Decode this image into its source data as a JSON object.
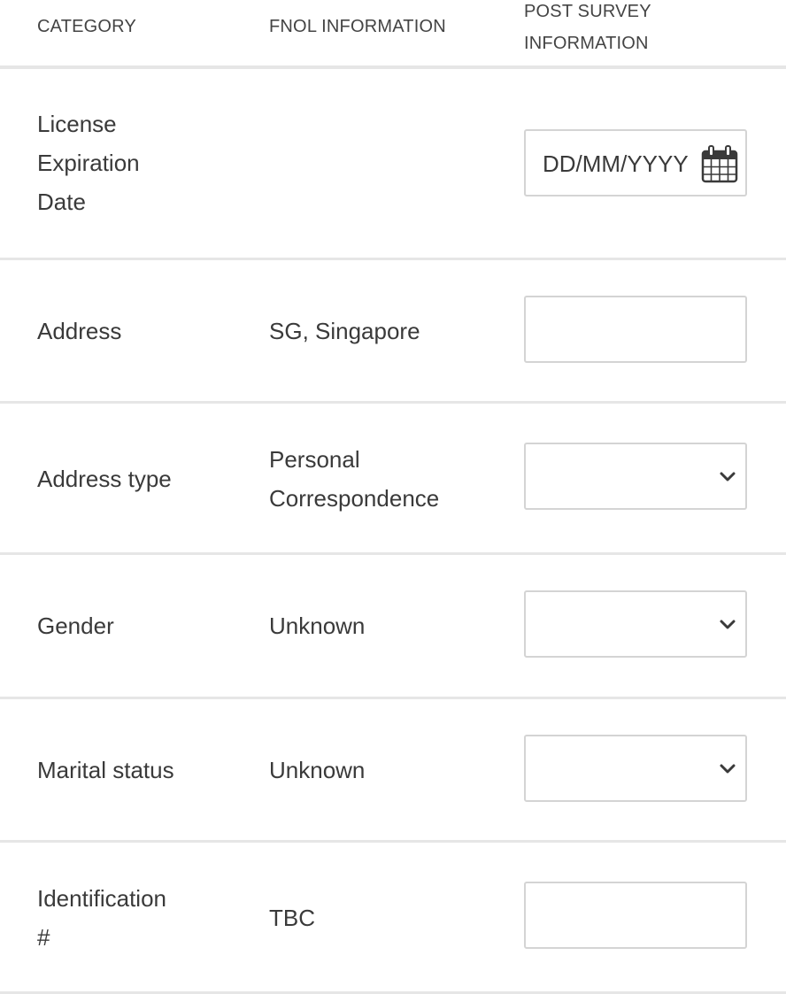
{
  "columns": {
    "category": "CATEGORY",
    "fnol": "FNOL INFORMATION",
    "post_survey_line1": "POST SURVEY",
    "post_survey_line2": "INFORMATION"
  },
  "rows": [
    {
      "category_lines": [
        "License",
        "Expiration",
        "Date"
      ],
      "fnol_lines": [],
      "input": {
        "type": "date",
        "placeholder": "DD/MM/YYYY",
        "value": "",
        "icon": "calendar-icon"
      }
    },
    {
      "category_lines": [
        "Address"
      ],
      "fnol_lines": [
        "SG, Singapore"
      ],
      "input": {
        "type": "text",
        "value": ""
      }
    },
    {
      "category_lines": [
        "Address type"
      ],
      "fnol_lines": [
        "Personal",
        "Correspondence"
      ],
      "input": {
        "type": "select",
        "value": "",
        "icon": "chevron-down-icon"
      }
    },
    {
      "category_lines": [
        "Gender"
      ],
      "fnol_lines": [
        "Unknown"
      ],
      "input": {
        "type": "select",
        "value": "",
        "icon": "chevron-down-icon"
      }
    },
    {
      "category_lines": [
        "Marital status"
      ],
      "fnol_lines": [
        "Unknown"
      ],
      "input": {
        "type": "select",
        "value": "",
        "icon": "chevron-down-icon"
      }
    },
    {
      "category_lines": [
        "Identification",
        "#"
      ],
      "fnol_lines": [
        "TBC"
      ],
      "input": {
        "type": "text",
        "value": ""
      }
    }
  ],
  "colors": {
    "text": "#3a3a3a",
    "border": "#d4d4d4",
    "divider": "#e6e6e6",
    "icon": "#3a3a3a"
  }
}
